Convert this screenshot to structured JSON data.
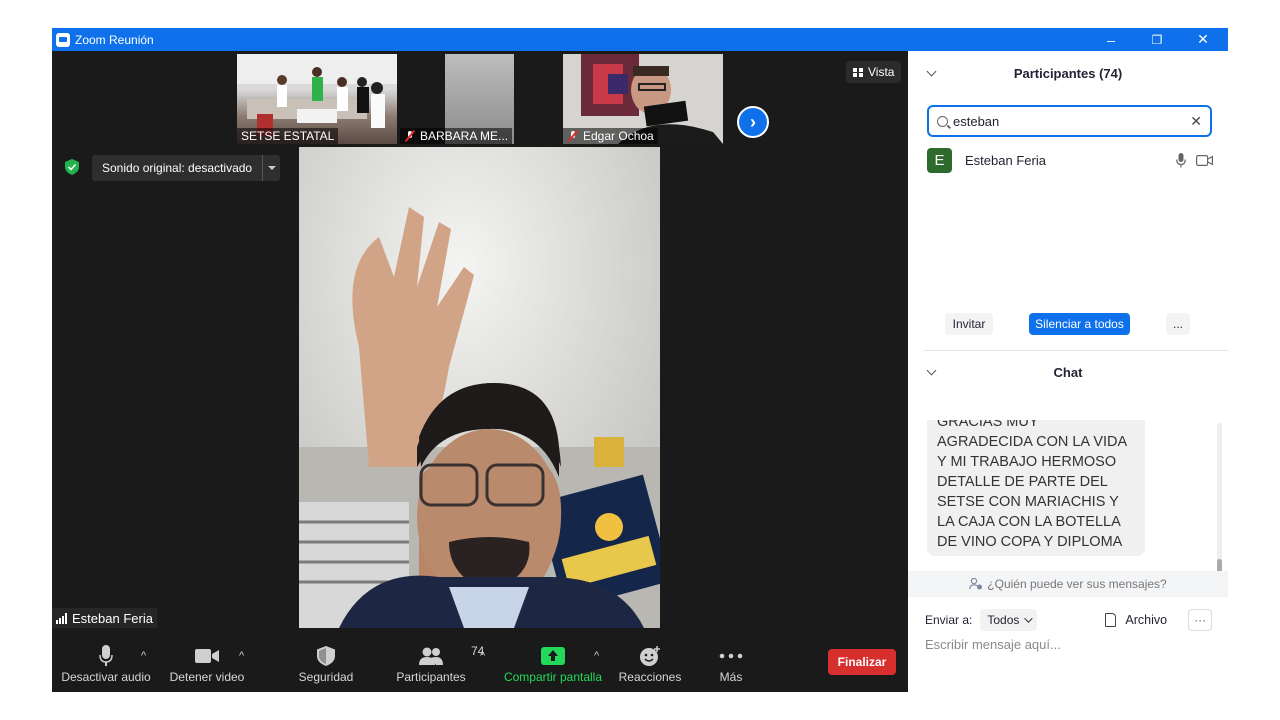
{
  "window": {
    "title": "Zoom Reunión",
    "minimize": "–",
    "restore": "❐",
    "close": "✕"
  },
  "thumbnails": [
    {
      "label": "SETSE ESTATAL",
      "muted": false
    },
    {
      "label": "BARBARA ME...",
      "muted": true
    },
    {
      "label": "Edgar Ochoa",
      "muted": true
    }
  ],
  "view_button": "Vista",
  "sound_original": "Sonido original: desactivado",
  "active_speaker": "Esteban Feria",
  "toolbar": {
    "audio": "Desactivar audio",
    "video": "Detener video",
    "security": "Seguridad",
    "participants": "Participantes",
    "participants_count": "74",
    "share": "Compartir pantalla",
    "reactions": "Reacciones",
    "more": "Más",
    "end": "Finalizar"
  },
  "participants_panel": {
    "title": "Participantes (74)",
    "search_value": "esteban",
    "results": [
      {
        "initial": "E",
        "name": "Esteban Feria"
      }
    ],
    "invite": "Invitar",
    "mute_all": "Silenciar a todos",
    "more": "..."
  },
  "chat": {
    "title": "Chat",
    "message": "GRACIAS MUY AGRADECIDA CON LA VIDA Y MI TRABAJO HERMOSO DETALLE DE PARTE DEL SETSE CON MARIACHIS Y LA CAJA CON LA BOTELLA DE VINO COPA Y DIPLOMA",
    "who_can_see": "¿Quién puede ver sus mensajes?",
    "send_to_label": "Enviar a:",
    "send_to_value": "Todos",
    "file": "Archivo",
    "more": "···",
    "input_placeholder": "Escribir mensaje aquí..."
  },
  "colors": {
    "zoom_blue": "#0e71eb",
    "end_red": "#d72e2e",
    "share_green": "#23d959",
    "dark_bg": "#1a1a1a"
  }
}
